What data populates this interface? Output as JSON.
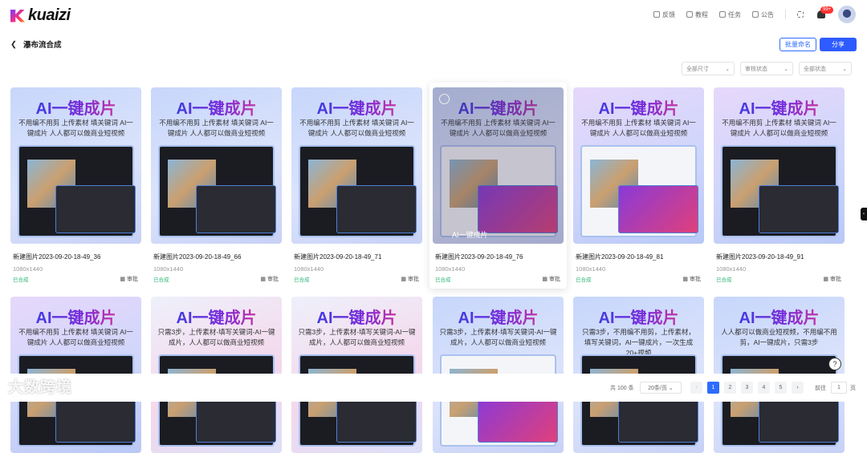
{
  "header": {
    "logo": "kuaizi",
    "nav": [
      "反馈",
      "教程",
      "任务",
      "公告"
    ],
    "badge": "99+"
  },
  "page": {
    "title": "瀑布流合成",
    "rename": "批量命名",
    "share": "分享"
  },
  "filters": [
    "全部尺寸",
    "审核状态",
    "全部状态"
  ],
  "card_title": "AI一键成片",
  "row1": [
    {
      "name": "新建图片2023-09-20-18-49_36",
      "size": "1080x1440",
      "status": "已合成",
      "approve": "审批",
      "sub": "不用编不用剪 上传素材 填关键词 AI一键成片 人人都可以做商业短视频"
    },
    {
      "name": "新建图片2023-09-20-18-49_66",
      "size": "1080x1440",
      "status": "已合成",
      "approve": "审批",
      "sub": "不用编不用剪 上传素材 填关键词 AI一键成片 人人都可以做商业短视频"
    },
    {
      "name": "新建图片2023-09-20-18-49_71",
      "size": "1080x1440",
      "status": "已合成",
      "approve": "审批",
      "sub": "不用编不用剪 上传素材 填关键词 AI一键成片 人人都可以做商业短视频"
    },
    {
      "name": "新建图片2023-09-20-18-49_76",
      "size": "1080x1440",
      "status": "已合成",
      "approve": "审批",
      "sub": "不用编不用剪 上传素材 填关键词 AI一键成片 人人都可以做商业短视频"
    },
    {
      "name": "新建图片2023-09-20-18-49_81",
      "size": "1080x1440",
      "status": "已合成",
      "approve": "审批",
      "sub": "不用编不用剪 上传素材 填关键词 AI一键成片 人人都可以做商业短视频"
    },
    {
      "name": "新建图片2023-09-20-18-49_91",
      "size": "1080x1440",
      "status": "已合成",
      "approve": "审批",
      "sub": "不用编不用剪 上传素材 填关键词 AI一键成片 人人都可以做商业短视频"
    }
  ],
  "row2": [
    {
      "sub": "不用编不用剪 上传素材 填关键词 AI一键成片 人人都可以做商业短视频"
    },
    {
      "sub": "只需3步，上传素材-填写关键词-AI一键成片，人人都可以做商业短视频"
    },
    {
      "sub": "只需3步，上传素材-填写关键词-AI一键成片，人人都可以做商业短视频"
    },
    {
      "sub": "只需3步，上传素材-填写关键词-AI一键成片，人人都可以做商业短视频"
    },
    {
      "sub": "只需3步，不用编不用剪，上传素材，填写关键词，AI一键成片，一次生成20+视频"
    },
    {
      "sub": "人人都可以做商业短视频，不用编不用剪，AI一键成片，只需3步"
    }
  ],
  "hover_label": "AI一键成片",
  "pagination": {
    "total": "共 100 条",
    "per_page": "20条/页",
    "pages": [
      "1",
      "2",
      "3",
      "4",
      "5"
    ],
    "current": "1",
    "goto": "前往",
    "goto_value": "1",
    "page_unit": "页"
  },
  "watermark": "大数跨境"
}
